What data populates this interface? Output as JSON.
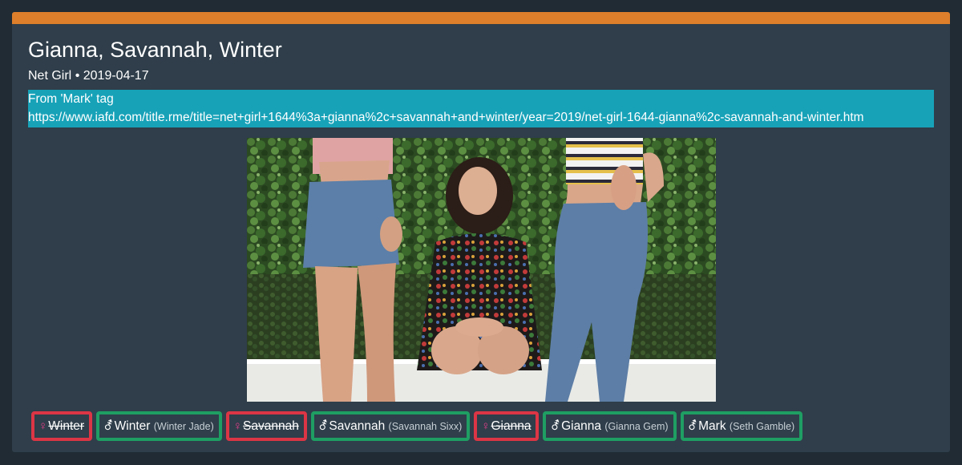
{
  "scene": {
    "title": "Gianna, Savannah, Winter",
    "studio": "Net Girl",
    "separator": "•",
    "date": "2019-04-17",
    "info": {
      "line1": "From 'Mark' tag",
      "line2": "https://www.iafd.com/title.rme/title=net+girl+1644%3a+gianna%2c+savannah+and+winter/year=2019/net-girl-1644-gianna%2c-savannah-and-winter.htm"
    }
  },
  "colors": {
    "page_bg": "#202b33",
    "card_bg": "#2f3e4a",
    "top_bar": "#dd7f2b",
    "info_bg": "#17a2b8",
    "tag_removed": "#dc3545",
    "tag_added": "#1f9e63",
    "female_symbol": "#e83e8c"
  },
  "tags": [
    {
      "status": "removed",
      "icon": "female-icon",
      "symbol": "♀",
      "name": "Winter",
      "alias": ""
    },
    {
      "status": "added",
      "icon": "male-female-icon",
      "symbol": "⚦",
      "name": "Winter",
      "alias": "(Winter Jade)"
    },
    {
      "status": "removed",
      "icon": "female-icon",
      "symbol": "♀",
      "name": "Savannah",
      "alias": ""
    },
    {
      "status": "added",
      "icon": "male-female-icon",
      "symbol": "⚦",
      "name": "Savannah",
      "alias": "(Savannah Sixx)"
    },
    {
      "status": "removed",
      "icon": "female-icon",
      "symbol": "♀",
      "name": "Gianna",
      "alias": ""
    },
    {
      "status": "added",
      "icon": "male-female-icon",
      "symbol": "⚦",
      "name": "Gianna",
      "alias": "(Gianna Gem)"
    },
    {
      "status": "added",
      "icon": "male-female-icon",
      "symbol": "⚦",
      "name": "Mark",
      "alias": "(Seth Gamble)"
    }
  ]
}
